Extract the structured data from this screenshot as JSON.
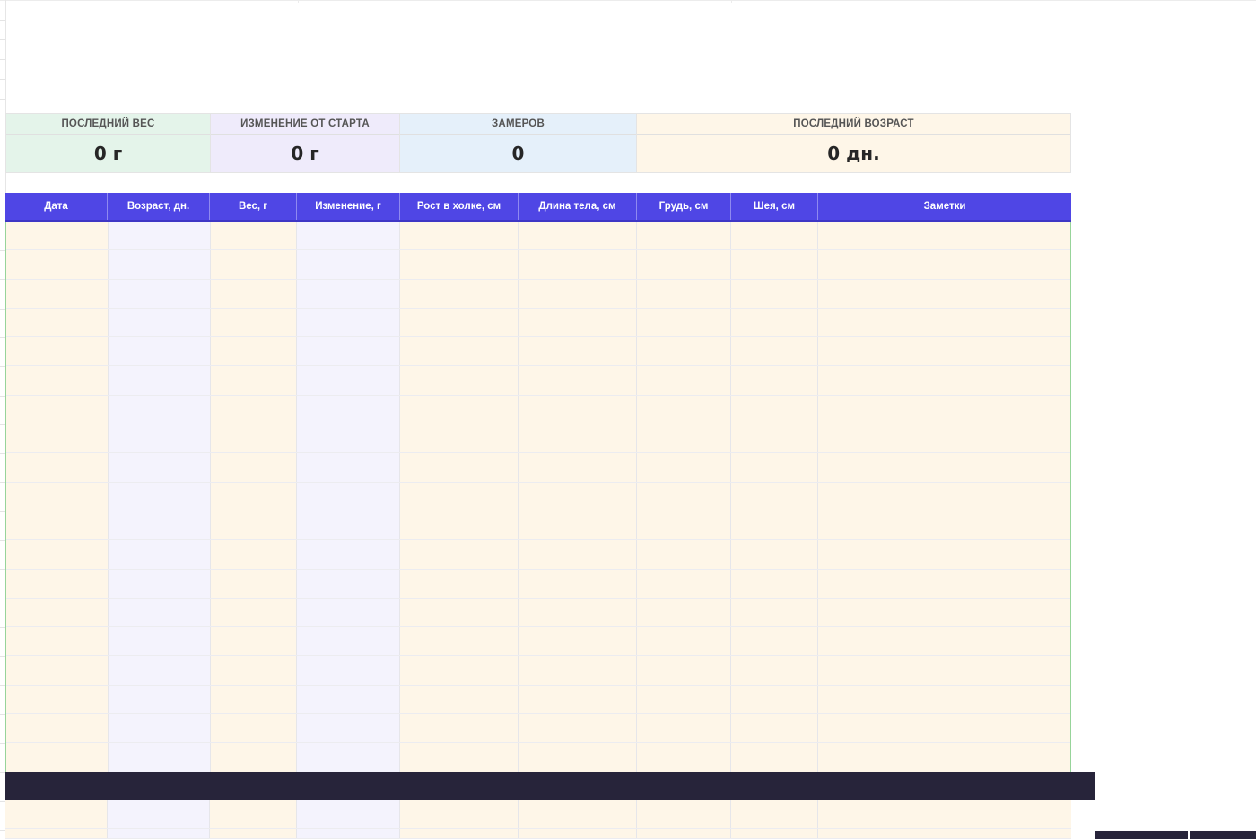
{
  "summary": {
    "cards": [
      {
        "label": "ПОСЛЕДНИЙ ВЕС",
        "value": "0 г",
        "color": "#e4f4ea"
      },
      {
        "label": "ИЗМЕНЕНИЕ ОТ СТАРТА",
        "value": "0 г",
        "color": "#efebfb"
      },
      {
        "label": "ЗАМЕРОВ",
        "value": "0",
        "color": "#e5f0fa"
      },
      {
        "label": "ПОСЛЕДНИЙ ВОЗРАСТ",
        "value": "0 дн.",
        "color": "#fef6e8"
      }
    ]
  },
  "table": {
    "header_color": "#4f46e5",
    "columns": [
      "Дата",
      "Возраст, дн.",
      "Вес, г",
      "Изменение, г",
      "Рост в холке, см",
      "Длина тела, см",
      "Грудь, см",
      "Шея, см",
      "Заметки"
    ]
  }
}
